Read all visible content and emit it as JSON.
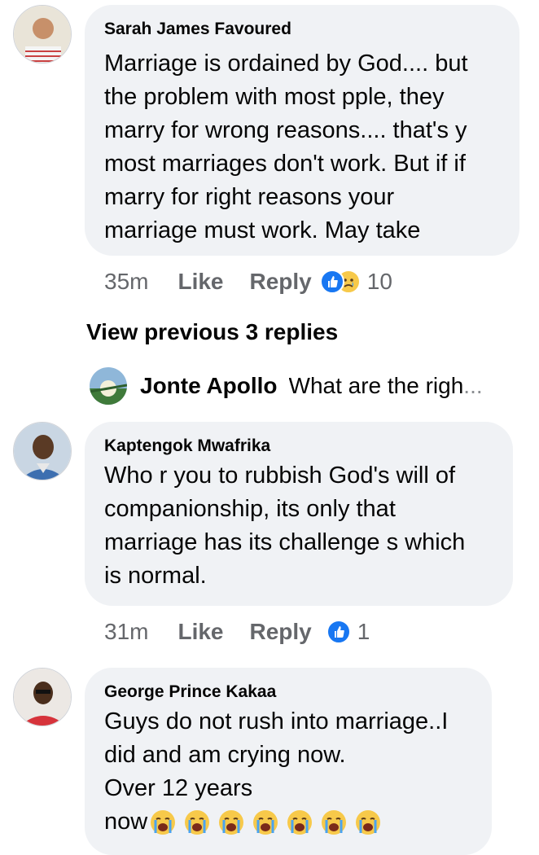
{
  "comments": [
    {
      "author": "Sarah James Favoured",
      "lines": [
        "Marriage is ordained by God.... but",
        "the problem with most pple, they",
        "marry for wrong reasons.... that's y",
        "most marriages don't work. But if if",
        "marry for right reasons your",
        "marriage must work. May take"
      ],
      "time": "35m",
      "like_label": "Like",
      "reply_label": "Reply",
      "reaction_count": "10",
      "reactions": [
        "like-icon",
        "sad-icon"
      ]
    },
    {
      "author": "Kaptengok Mwafrika",
      "lines": [
        "Who r you to rubbish God's will of",
        "companionship, its only that",
        "marriage has its challenge s which",
        "is normal."
      ],
      "time": "31m",
      "like_label": "Like",
      "reply_label": "Reply",
      "reaction_count": "1",
      "reactions": [
        "like-icon"
      ]
    },
    {
      "author": "George Prince Kakaa",
      "lines": [
        "Guys do not rush into marriage..I",
        "did and am crying now.",
        "Over 12 years",
        "now"
      ],
      "emoji": "loudly-crying-face x7"
    }
  ],
  "view_previous": "View previous 3 replies",
  "reply_preview": {
    "author": "Jonte Apollo",
    "text": "What are the righ",
    "ellipsis": "..."
  },
  "colors": {
    "bubble": "#f0f2f5",
    "meta_text": "#65676b",
    "like_blue": "#1877f2",
    "text": "#050505"
  }
}
